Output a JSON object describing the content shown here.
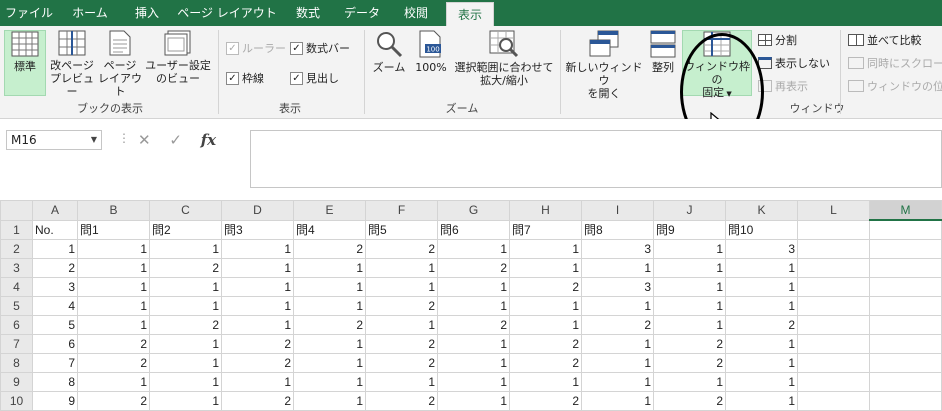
{
  "tabs": [
    {
      "label": "ファイル",
      "active": false
    },
    {
      "label": "ホーム",
      "active": false
    },
    {
      "label": "挿入",
      "active": false
    },
    {
      "label": "ページ レイアウト",
      "active": false
    },
    {
      "label": "数式",
      "active": false
    },
    {
      "label": "データ",
      "active": false
    },
    {
      "label": "校閲",
      "active": false
    },
    {
      "label": "表示",
      "active": true
    }
  ],
  "ribbon": {
    "book_view": {
      "group_label": "ブックの表示",
      "normal": "標準",
      "page_break_1": "改ページ",
      "page_break_2": "プレビュー",
      "page_layout_1": "ページ",
      "page_layout_2": "レイアウト",
      "custom_view_1": "ユーザー設定",
      "custom_view_2": "のビュー"
    },
    "show": {
      "group_label": "表示",
      "ruler": "ルーラー",
      "formula_bar": "数式バー",
      "gridlines": "枠線",
      "headings": "見出し"
    },
    "zoom": {
      "group_label": "ズーム",
      "zoom": "ズーム",
      "zoom100": "100%",
      "zoom_sel_1": "選択範囲に合わせて",
      "zoom_sel_2": "拡大/縮小",
      "icon_100": "100"
    },
    "window": {
      "group_label": "ウィンドウ",
      "new_window_1": "新しいウィンドウ",
      "new_window_2": "を開く",
      "arrange": "整列",
      "freeze_1": "ウィンドウ枠の",
      "freeze_2": "固定",
      "split": "分割",
      "hide": "表示しない",
      "unhide": "再表示",
      "side_by_side": "並べて比較",
      "sync_scroll": "同時にスクロール",
      "reset_position": "ウィンドウの位置"
    }
  },
  "formula_bar": {
    "name_box": "M16",
    "fx": "fx",
    "value": ""
  },
  "sheet": {
    "columns": [
      "A",
      "B",
      "C",
      "D",
      "E",
      "F",
      "G",
      "H",
      "I",
      "J",
      "K",
      "L",
      "M"
    ],
    "selected_column": "M",
    "rows": [
      {
        "n": "1",
        "cells": [
          "No.",
          "問1",
          "問2",
          "問3",
          "問4",
          "問5",
          "問6",
          "問7",
          "問8",
          "問9",
          "問10",
          "",
          ""
        ]
      },
      {
        "n": "2",
        "cells": [
          "1",
          "1",
          "1",
          "1",
          "2",
          "2",
          "1",
          "1",
          "3",
          "1",
          "3",
          "",
          ""
        ]
      },
      {
        "n": "3",
        "cells": [
          "2",
          "1",
          "2",
          "1",
          "1",
          "1",
          "2",
          "1",
          "1",
          "1",
          "1",
          "",
          ""
        ]
      },
      {
        "n": "4",
        "cells": [
          "3",
          "1",
          "1",
          "1",
          "1",
          "1",
          "1",
          "2",
          "3",
          "1",
          "1",
          "",
          ""
        ]
      },
      {
        "n": "5",
        "cells": [
          "4",
          "1",
          "1",
          "1",
          "1",
          "2",
          "1",
          "1",
          "1",
          "1",
          "1",
          "",
          ""
        ]
      },
      {
        "n": "6",
        "cells": [
          "5",
          "1",
          "2",
          "1",
          "2",
          "1",
          "2",
          "1",
          "2",
          "1",
          "2",
          "",
          ""
        ]
      },
      {
        "n": "7",
        "cells": [
          "6",
          "2",
          "1",
          "2",
          "1",
          "2",
          "1",
          "2",
          "1",
          "2",
          "1",
          "",
          ""
        ]
      },
      {
        "n": "8",
        "cells": [
          "7",
          "2",
          "1",
          "2",
          "1",
          "2",
          "1",
          "2",
          "1",
          "2",
          "1",
          "",
          ""
        ]
      },
      {
        "n": "9",
        "cells": [
          "8",
          "1",
          "1",
          "1",
          "1",
          "1",
          "1",
          "1",
          "1",
          "1",
          "1",
          "",
          ""
        ]
      },
      {
        "n": "10",
        "cells": [
          "9",
          "2",
          "1",
          "2",
          "1",
          "2",
          "1",
          "2",
          "1",
          "2",
          "1",
          "",
          ""
        ]
      }
    ]
  }
}
